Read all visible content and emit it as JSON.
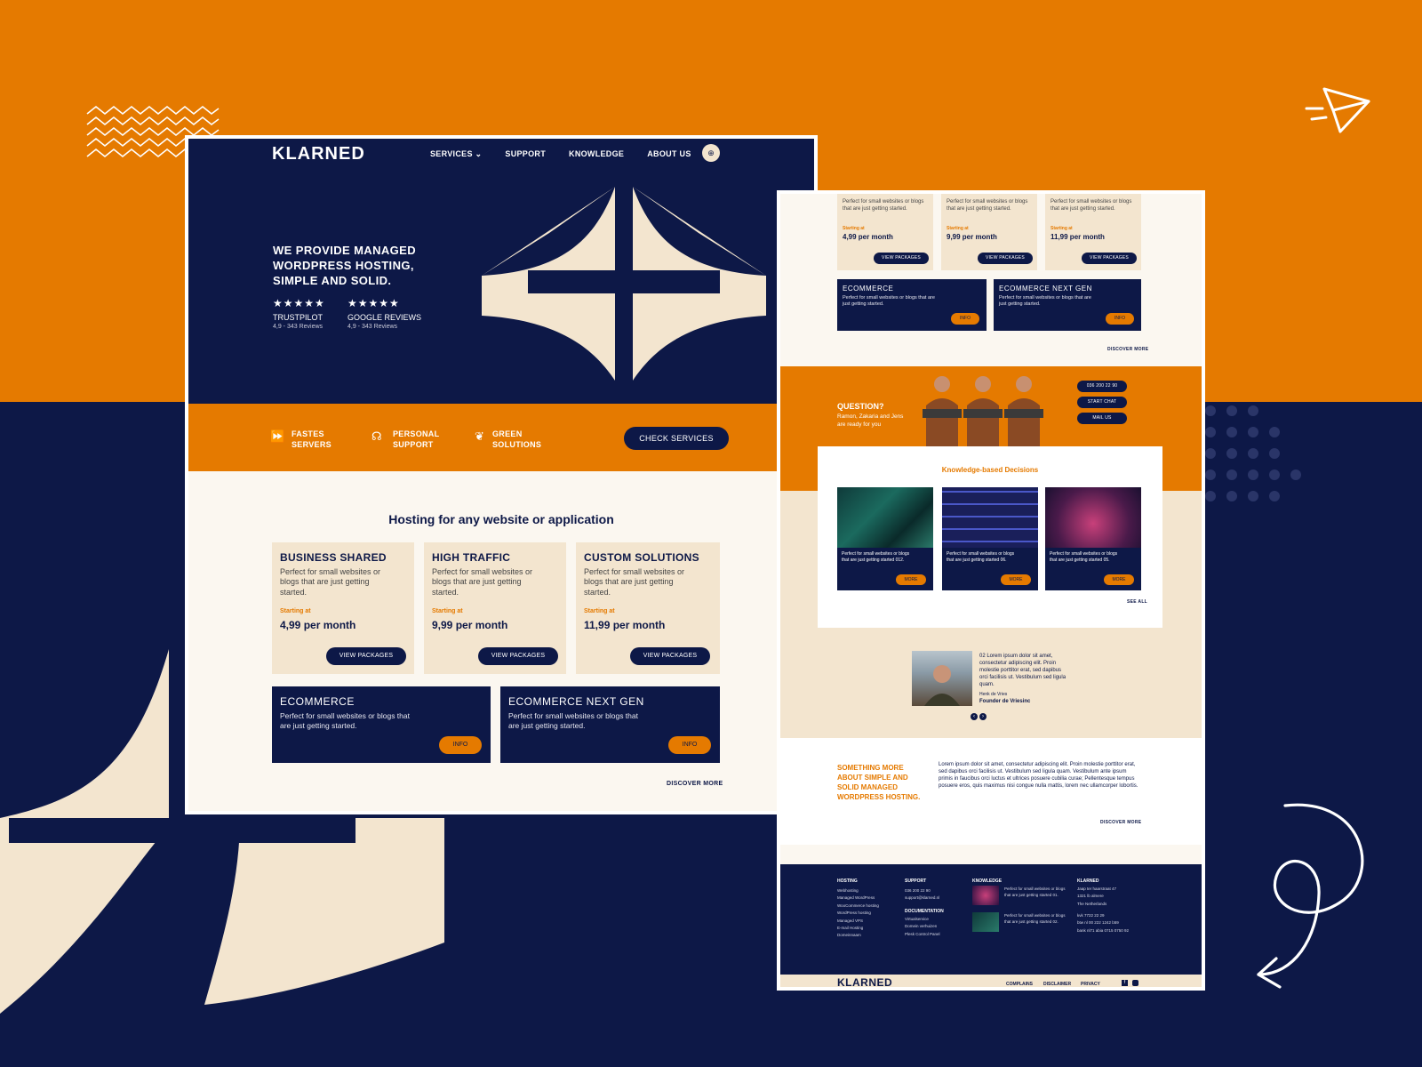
{
  "colors": {
    "orange": "#e57a00",
    "navy": "#0d1847",
    "beige": "#f3e5cf",
    "cream": "#fbf7f0"
  },
  "left": {
    "logo": "KLARNED",
    "nav": {
      "services": "SERVICES ⌄",
      "support": "SUPPORT",
      "knowledge": "KNOWLEDGE",
      "about": "ABOUT US"
    },
    "hero_title": "WE PROVIDE MANAGED WORDPRESS HOSTING, SIMPLE AND SOLID.",
    "reviews": [
      {
        "stars": "★★★★★",
        "name": "TRUSTPILOT",
        "score": "4,9 - 343 Reviews"
      },
      {
        "stars": "★★★★★",
        "name": "GOOGLE REVIEWS",
        "score": "4,9 - 343 Reviews"
      }
    ],
    "features": [
      {
        "icon": "fast-forward-icon",
        "label": "FASTES\nSERVERS"
      },
      {
        "icon": "headset-icon",
        "label": "PERSONAL\nSUPPORT"
      },
      {
        "icon": "leaf-icon",
        "label": "GREEN\nSOLUTIONS"
      }
    ],
    "check_services": "CHECK SERVICES",
    "section_title": "Hosting for any website or application",
    "cards": [
      {
        "title": "BUSINESS SHARED",
        "desc": "Perfect for small websites or blogs that are just getting started.",
        "starting": "Starting at",
        "price": "4,99 per month",
        "button": "VIEW PACKAGES"
      },
      {
        "title": "HIGH TRAFFIC",
        "desc": "Perfect for small websites or blogs that are just getting started.",
        "starting": "Starting at",
        "price": "9,99 per month",
        "button": "VIEW PACKAGES"
      },
      {
        "title": "CUSTOM SOLUTIONS",
        "desc": "Perfect for small websites or blogs that are just getting started.",
        "starting": "Starting at",
        "price": "11,99 per month",
        "button": "VIEW PACKAGES"
      }
    ],
    "navy_cards": [
      {
        "title": "ECOMMERCE",
        "desc": "Perfect for small websites or blogs that are just getting started.",
        "button": "INFO"
      },
      {
        "title": "ECOMMERCE NEXT GEN",
        "desc": "Perfect for small websites or blogs that are just getting started.",
        "button": "INFO"
      }
    ],
    "discover": "DISCOVER MORE"
  },
  "right": {
    "cards": [
      {
        "desc": "Perfect for small websites or blogs that are just getting started.",
        "starting": "Starting at",
        "price": "4,99 per month",
        "button": "VIEW PACKAGES"
      },
      {
        "desc": "Perfect for small websites or blogs that are just getting started.",
        "starting": "Starting at",
        "price": "9,99 per month",
        "button": "VIEW PACKAGES"
      },
      {
        "desc": "Perfect for small websites or blogs that are just getting started.",
        "starting": "Starting at",
        "price": "11,99 per month",
        "button": "VIEW PACKAGES"
      }
    ],
    "navy_cards": [
      {
        "title": "ECOMMERCE",
        "desc": "Perfect for small websites or blogs that are just getting started.",
        "button": "INFO"
      },
      {
        "title": "ECOMMERCE NEXT GEN",
        "desc": "Perfect for small websites or blogs that are just getting started.",
        "button": "INFO"
      }
    ],
    "discover1": "DISCOVER MORE",
    "question_title": "QUESTION?",
    "question_text": "Ramon, Zakaria and Jens are ready for you",
    "contact_buttons": [
      "036 200 22 90",
      "START CHAT",
      "MAIL US"
    ],
    "knowledge_title": "Knowledge-based Decisions",
    "articles": [
      {
        "desc": "Perfect for small websites or blogs that are just getting started 012.",
        "button": "MORE"
      },
      {
        "desc": "Perfect for small websites or blogs that are just getting started 06.",
        "button": "MORE"
      },
      {
        "desc": "Perfect for small websites or blogs that are just getting started 05.",
        "button": "MORE"
      }
    ],
    "see_all": "SEE ALL",
    "testimonial_text": "02 Lorem ipsum dolor sit amet, consectetur adipiscing elit. Proin molestie porttitor erat, sed dapibus orci facilisis ut. Vestibulum sed ligula quam.",
    "testimonial_name": "Henk de Vries",
    "testimonial_role": "Founder de Vriesinc",
    "more_title": "SOMETHING MORE ABOUT SIMPLE AND SOLID MANAGED WORDPRESS HOSTING.",
    "more_text": "Lorem ipsum dolor sit amet, consectetur adipiscing elit. Proin molestie porttitor erat, sed dapibus orci facilisis ut. Vestibulum sed ligula quam. Vestibulum ante ipsum primis in faucibus orci luctus et ultrices posuere cubilia curae; Pellentesque tempus posuere eros, quis maximus nisi congue nulla mattis, lorem nec ullamcorper lobortis.",
    "discover2": "DISCOVER MORE",
    "footer": {
      "hosting_title": "HOSTING",
      "hosting": [
        "Webhosting",
        "Managed WordPress",
        "WooCommerce hosting",
        "WordPress hosting",
        "Managed VPS",
        "E-mail Hosting",
        "Domeinnaam"
      ],
      "support_title": "SUPPORT",
      "support": [
        "036 200 22 90",
        "support@klarned.nl"
      ],
      "docs_title": "DOCUMENTATION",
      "docs": [
        "Virtualservice",
        "Domein verhuizen",
        "Plesk Control Panel"
      ],
      "knowledge_title": "KNOWLEDGE",
      "knowledge": [
        "Perfect for small websites or blogs that are just getting started 01.",
        "Perfect for small websites or blogs that are just getting started 02."
      ],
      "klarned_title": "KLARNED",
      "address": [
        "Jaap ter haarstraat 47",
        "1321 lb almere",
        "The Netherlands"
      ],
      "company": [
        "kvk 7722 22 29",
        "btw nl 00 222 1242 b59",
        "bank nl71 abia 0715 0750 92"
      ],
      "logo": "KLARNED",
      "links": [
        "COMPLAINS",
        "DISCLAIMER",
        "PRIVACY"
      ]
    }
  }
}
